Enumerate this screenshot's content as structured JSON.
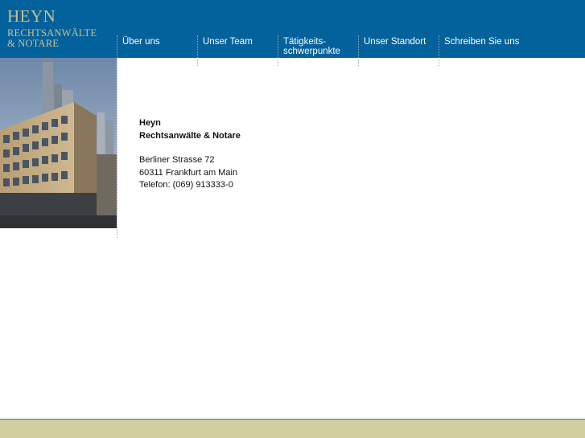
{
  "logo": {
    "name": "HEYN",
    "line1": "RECHTSANWÄLTE",
    "line2": "& NOTARE"
  },
  "nav": [
    {
      "label": "Über uns"
    },
    {
      "label": "Unser Team"
    },
    {
      "label": "Tätigkeits-\nschwerpunkte"
    },
    {
      "label": "Unser Standort"
    },
    {
      "label": "Schreiben Sie uns"
    }
  ],
  "contact": {
    "name": "Heyn",
    "firm": "Rechtsanwälte & Notare",
    "street": "Berliner Strasse 72",
    "city": "60311 Frankfurt am Main",
    "phone": "Telefon: (069) 913333-0"
  },
  "colors": {
    "header": "#03619b",
    "logo": "#c9c08f",
    "footer": "#d2ce9f"
  }
}
